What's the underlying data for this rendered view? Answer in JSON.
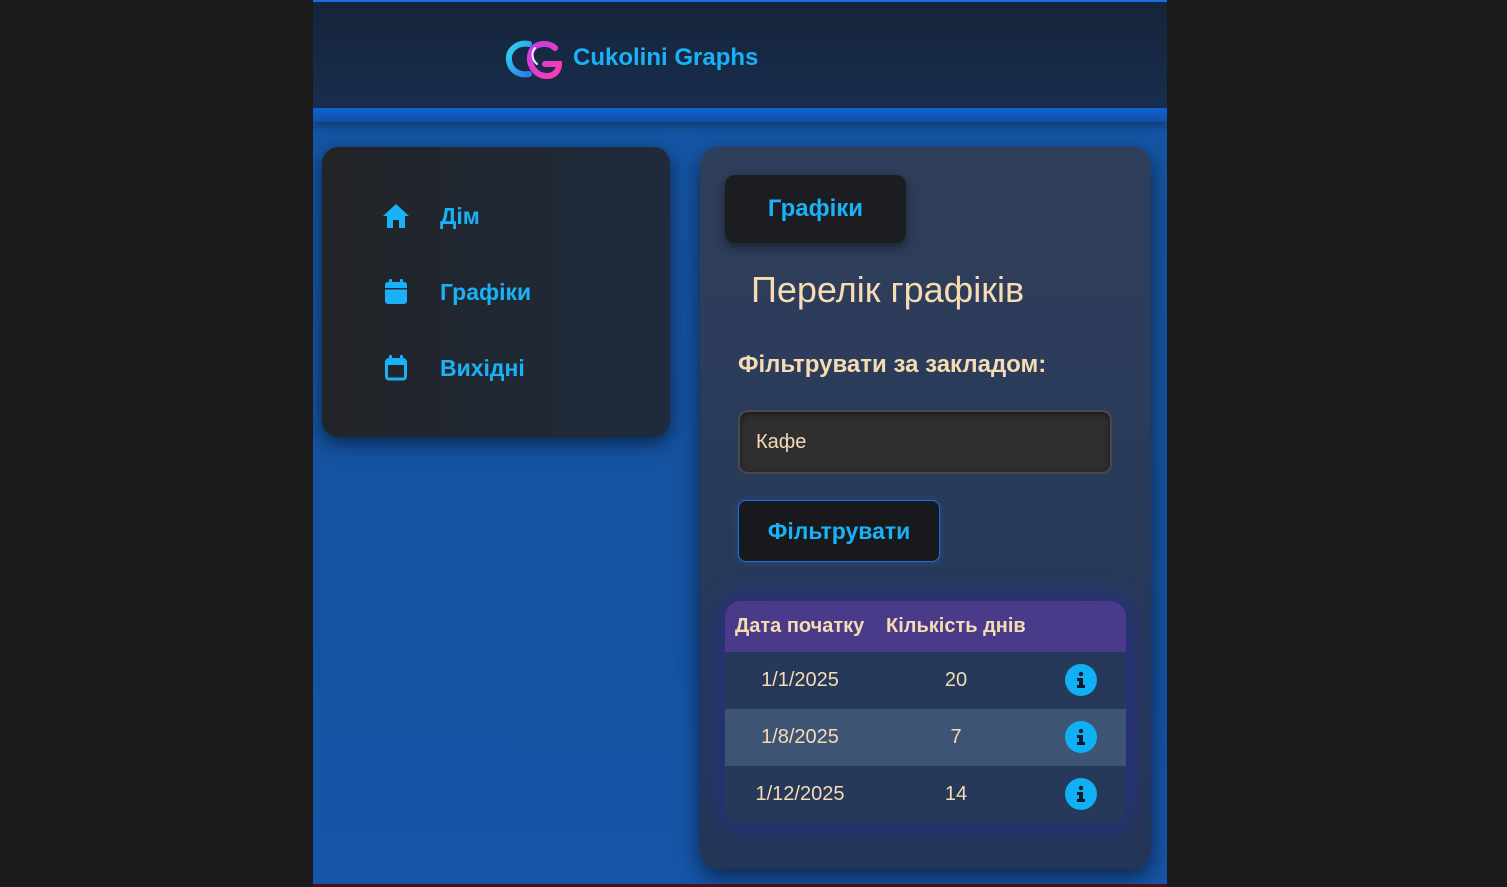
{
  "brand": {
    "name": "Cukolini Graphs",
    "logo_icon": "cg-logo-icon"
  },
  "sidebar": {
    "items": [
      {
        "label": "Дім",
        "icon": "home-icon"
      },
      {
        "label": "Графіки",
        "icon": "calendar-filled-icon"
      },
      {
        "label": "Вихідні",
        "icon": "calendar-outline-icon"
      }
    ]
  },
  "main": {
    "tab_label": "Графіки",
    "title": "Перелік графіків",
    "filter": {
      "label": "Фільтрувати за закладом:",
      "value": "Кафе",
      "button_label": "Фільтрувати"
    },
    "table": {
      "headers": [
        "Дата початку",
        "Кількість днів"
      ],
      "rows": [
        {
          "start_date": "1/1/2025",
          "days": "20"
        },
        {
          "start_date": "1/8/2025",
          "days": "7"
        },
        {
          "start_date": "1/12/2025",
          "days": "14"
        }
      ],
      "row_action_icon": "info-icon"
    }
  },
  "colors": {
    "accent": "#1ab2f7",
    "text_warm": "#f6dcb2",
    "header_row": "#4a3b8a",
    "app_blue": "#1556a6"
  }
}
